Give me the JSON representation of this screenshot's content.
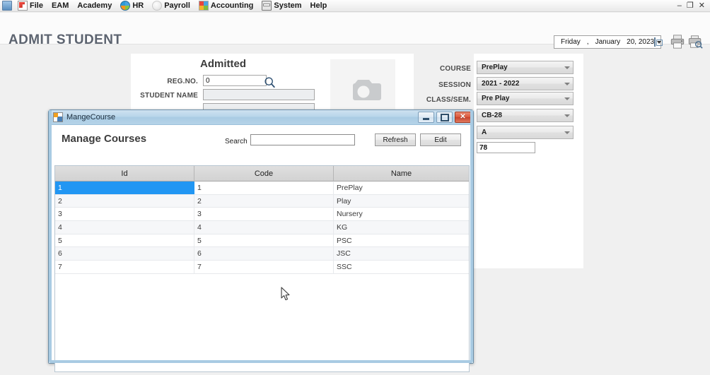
{
  "menubar": {
    "items": [
      {
        "label": "File",
        "icon": "file-icon"
      },
      {
        "label": "EAM",
        "icon": ""
      },
      {
        "label": "Academy",
        "icon": ""
      },
      {
        "label": "HR",
        "icon": "hr-globe-icon"
      },
      {
        "label": "Payroll",
        "icon": "payroll-icon"
      },
      {
        "label": "Accounting",
        "icon": "accounting-icon"
      },
      {
        "label": "System",
        "icon": "system-icon"
      },
      {
        "label": "Help",
        "icon": ""
      }
    ],
    "window_controls": {
      "minimize": "–",
      "restore": "❐",
      "close": "✕"
    }
  },
  "header": {
    "title": "ADMIT STUDENT",
    "date": {
      "weekday": "Friday",
      "comma": ",",
      "month": "January",
      "day_year": "20, 2023"
    },
    "print_icon": "printer-icon",
    "print_preview_icon": "print-preview-icon"
  },
  "form": {
    "section_title": "Admitted",
    "reg_no": {
      "label": "REG.NO.",
      "value": "0"
    },
    "student_name": {
      "label": "STUDENT NAME",
      "value": ""
    },
    "extra_field": {
      "value": ""
    },
    "search_icon": "magnifier-icon",
    "photo": {
      "placeholder_icon": "camera-icon"
    },
    "right_fields": [
      {
        "label": "COURSE",
        "value": "PrePlay",
        "type": "combo"
      },
      {
        "label": "SESSION",
        "value": "2021 - 2022",
        "type": "combo"
      },
      {
        "label": "CLASS/SEM.",
        "value": "Pre Play",
        "type": "combo"
      },
      {
        "label": "",
        "value": "CB-28",
        "type": "combo"
      },
      {
        "label": "",
        "value": "A",
        "type": "combo"
      },
      {
        "label": "",
        "value": "78",
        "type": "text"
      }
    ]
  },
  "dialog": {
    "titlebar": {
      "title": "MangeCourse",
      "icon": "form-icon",
      "minimize": "minimize-icon",
      "restore": "restore-icon",
      "close": "close-icon"
    },
    "heading": "Manage Courses",
    "search": {
      "label": "Search",
      "value": "",
      "placeholder": ""
    },
    "buttons": {
      "refresh": "Refresh",
      "edit": "Edit"
    },
    "grid": {
      "columns": [
        "Id",
        "Code",
        "Name"
      ],
      "rows": [
        {
          "id": "1",
          "code": "1",
          "name": "PrePlay",
          "selected": true
        },
        {
          "id": "2",
          "code": "2",
          "name": "Play",
          "selected": false
        },
        {
          "id": "3",
          "code": "3",
          "name": "Nursery",
          "selected": false
        },
        {
          "id": "4",
          "code": "4",
          "name": "KG",
          "selected": false
        },
        {
          "id": "5",
          "code": "5",
          "name": "PSC",
          "selected": false
        },
        {
          "id": "6",
          "code": "6",
          "name": "JSC",
          "selected": false
        },
        {
          "id": "7",
          "code": "7",
          "name": "SSC",
          "selected": false
        }
      ]
    }
  },
  "colors": {
    "selection_blue": "#2196f3",
    "window_chrome_blue": "#a9cbe3",
    "close_red": "#d9563a",
    "title_gray": "#5d6470"
  },
  "cursor": {
    "icon": "mouse-pointer"
  }
}
